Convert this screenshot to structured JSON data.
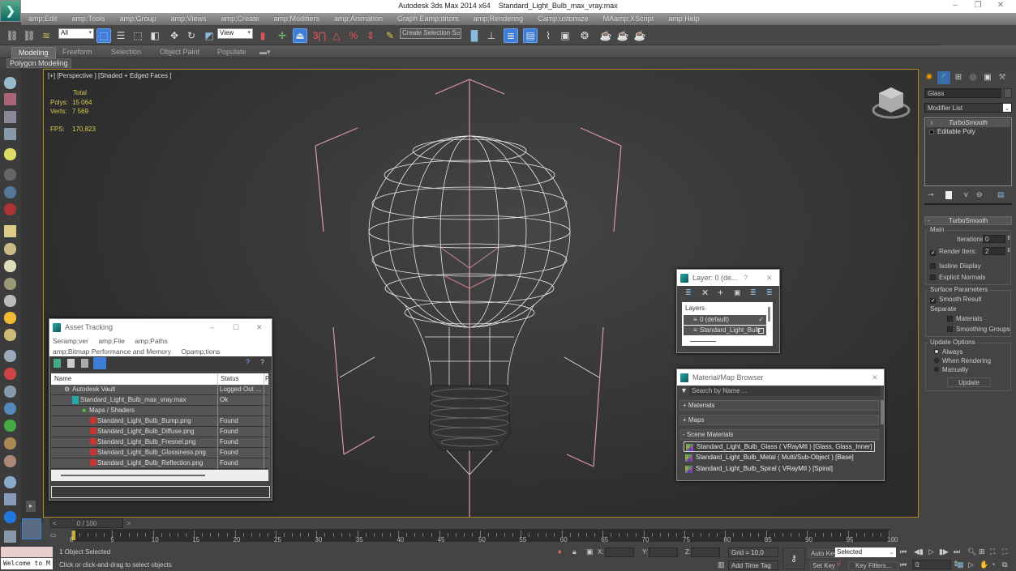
{
  "window": {
    "app_title": "Autodesk 3ds Max  2014 x64",
    "file_title": "Standard_Light_Bulb_max_vray.max",
    "minimize_icon": "minimize-icon",
    "restore_icon": "restore-icon",
    "close_icon": "close-icon"
  },
  "menu": [
    "amp;Edit",
    "amp;Tools",
    "amp;Group",
    "amp;Views",
    "amp;Create",
    "amp;Modifiers",
    "amp;Animation",
    "Graph Eamp;ditors",
    "amp;Rendering",
    "Camp;ustomize",
    "MAamp;XScript",
    "amp;Help"
  ],
  "toolbar": {
    "selection_filter": "All",
    "reference_coord": "View",
    "named_selection_placeholder": "Create Selection Se",
    "snap_label": "3"
  },
  "ribbon": {
    "tabs": [
      "Modeling",
      "Freeform",
      "Selection",
      "Object Paint",
      "Populate"
    ],
    "active_tab": "Modeling",
    "sub_label": "Polygon Modeling"
  },
  "viewport": {
    "label": "[+] [Perspective ] [Shaded + Edged Faces ]",
    "stats": {
      "total_label": "Total",
      "polys_label": "Polys:",
      "polys_value": "15 064",
      "verts_label": "Verts:",
      "verts_value": "7 569",
      "fps_label": "FPS:",
      "fps_value": "170,823"
    }
  },
  "command_panel": {
    "object_name": "Glass",
    "modifier_list": "Modifier List",
    "stack": [
      "TurboSmooth",
      "Editable Poly"
    ],
    "rollout_title": "TurboSmooth",
    "main_group": "Main",
    "iterations_label": "Iterations:",
    "iterations_value": "0",
    "render_iters_label": "Render Iters:",
    "render_iters_value": "2",
    "render_iters_checked": true,
    "isoline_label": "Isoline Display",
    "explicit_normals_label": "Explicit Normals",
    "surface_group": "Surface Parameters",
    "smooth_result_label": "Smooth Result",
    "smooth_result_checked": true,
    "separate_label": "Separate",
    "materials_label": "Materials",
    "smoothing_groups_label": "Smoothing Groups",
    "update_group": "Update Options",
    "update_options": [
      "Always",
      "When Rendering",
      "Manually"
    ],
    "update_selected": "Always",
    "update_button": "Update"
  },
  "asset_tracking": {
    "title": "Asset Tracking",
    "menu_row1": [
      "Seramp;ver",
      "amp;File",
      "amp;Paths"
    ],
    "menu_row2": [
      "amp;Bitmap Performance and Memory",
      "Opamp;tions"
    ],
    "columns": [
      "Name",
      "Status",
      "P"
    ],
    "rows": [
      {
        "name": "Autodesk Vault",
        "status": "Logged Out ..."
      },
      {
        "name": "Standard_Light_Bulb_max_vray.max",
        "status": "Ok"
      },
      {
        "name": "Maps / Shaders",
        "status": ""
      },
      {
        "name": "Standard_Light_Bulb_Bump.png",
        "status": "Found"
      },
      {
        "name": "Standard_Light_Bulb_Diffuse.png",
        "status": "Found"
      },
      {
        "name": "Standard_Light_Bulb_Fresnel.png",
        "status": "Found"
      },
      {
        "name": "Standard_Light_Bulb_Glossiness.png",
        "status": "Found"
      },
      {
        "name": "Standard_Light_Bulb_Reflection.png",
        "status": "Found"
      }
    ]
  },
  "layer_dialog": {
    "title": "Layer: 0 (de...",
    "help": "?",
    "header": "Layers",
    "layers": [
      "0 (default)",
      "Standard_Light_Bulb"
    ]
  },
  "material_browser": {
    "title": "Material/Map Browser",
    "search_placeholder": "Search by Name ...",
    "categories": [
      "+ Materials",
      "+ Maps",
      "- Scene Materials"
    ],
    "items": [
      "Standard_Light_Bulb_Glass  ( VRayMtl ) [Glass, Glass_Inner]",
      "Standard_Light_Bulb_Metal  ( Multi/Sub-Object ) [Base]",
      "Standard_Light_Bulb_Spiral  ( VRayMtl ) [Spiral]"
    ]
  },
  "timeline": {
    "frame_display": "0 / 100",
    "ticks": [
      "0",
      "5",
      "10",
      "15",
      "20",
      "25",
      "30",
      "35",
      "40",
      "45",
      "50",
      "55",
      "60",
      "65",
      "70",
      "75",
      "80",
      "85",
      "90",
      "95",
      "100"
    ]
  },
  "status": {
    "maxscript": "Welcome to M",
    "selection": "1 Object Selected",
    "prompt": "Click or click-and-drag to select objects",
    "x_label": "X:",
    "y_label": "Y:",
    "z_label": "Z:",
    "grid": "Grid = 10,0",
    "add_time_tag": "Add Time Tag",
    "auto_key": "Auto Key",
    "set_key": "Set Key",
    "key_mode": "Selected",
    "key_filters": "Key Filters...",
    "current_frame": "0"
  }
}
